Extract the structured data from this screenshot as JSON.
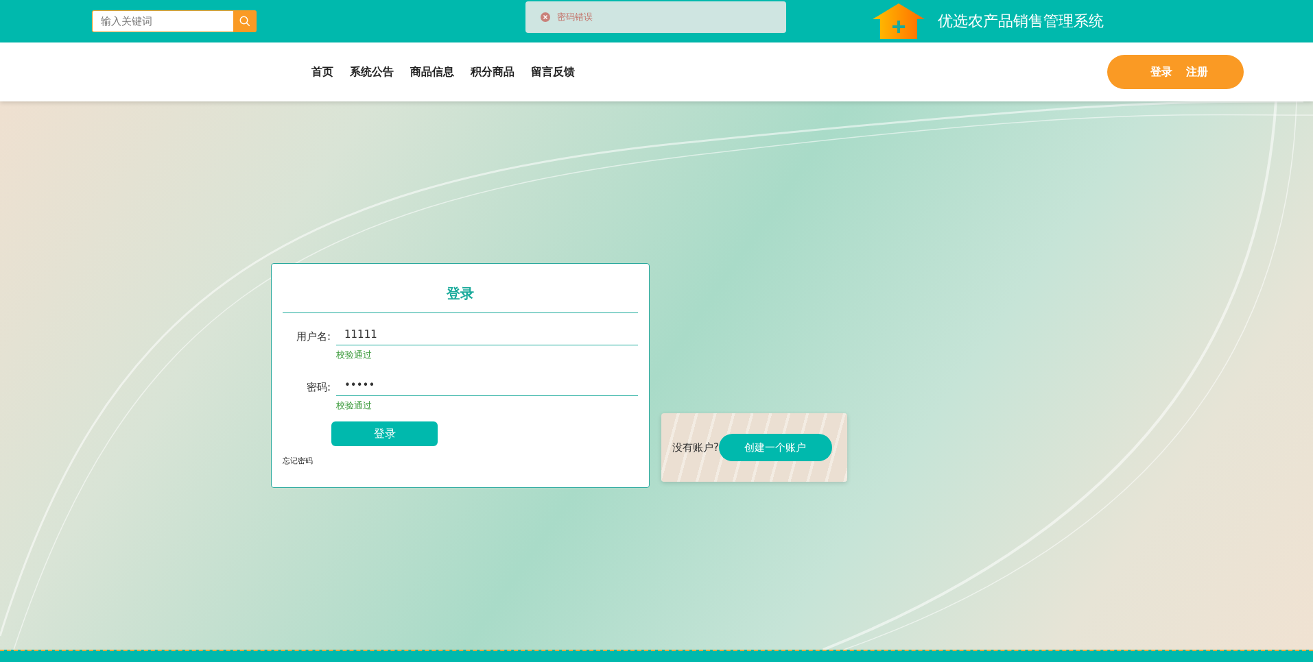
{
  "search": {
    "placeholder": "输入关键词"
  },
  "toast": {
    "kind": "error",
    "message": "密码错误"
  },
  "site_title": "优选农产品销售管理系统",
  "nav": [
    "首页",
    "系统公告",
    "商品信息",
    "积分商品",
    "留言反馈"
  ],
  "auth": {
    "login": "登录",
    "register": "注册"
  },
  "login_form": {
    "title": "登录",
    "fields": [
      {
        "label": "用户名:",
        "value": "11111",
        "hint": "校验通过"
      },
      {
        "label": "密码:",
        "value": "•••••",
        "hint": "校验通过"
      }
    ],
    "submit": "登录",
    "forgot": "忘记密码"
  },
  "signup": {
    "prompt": "没有账户?",
    "button": "创建一个账户"
  }
}
